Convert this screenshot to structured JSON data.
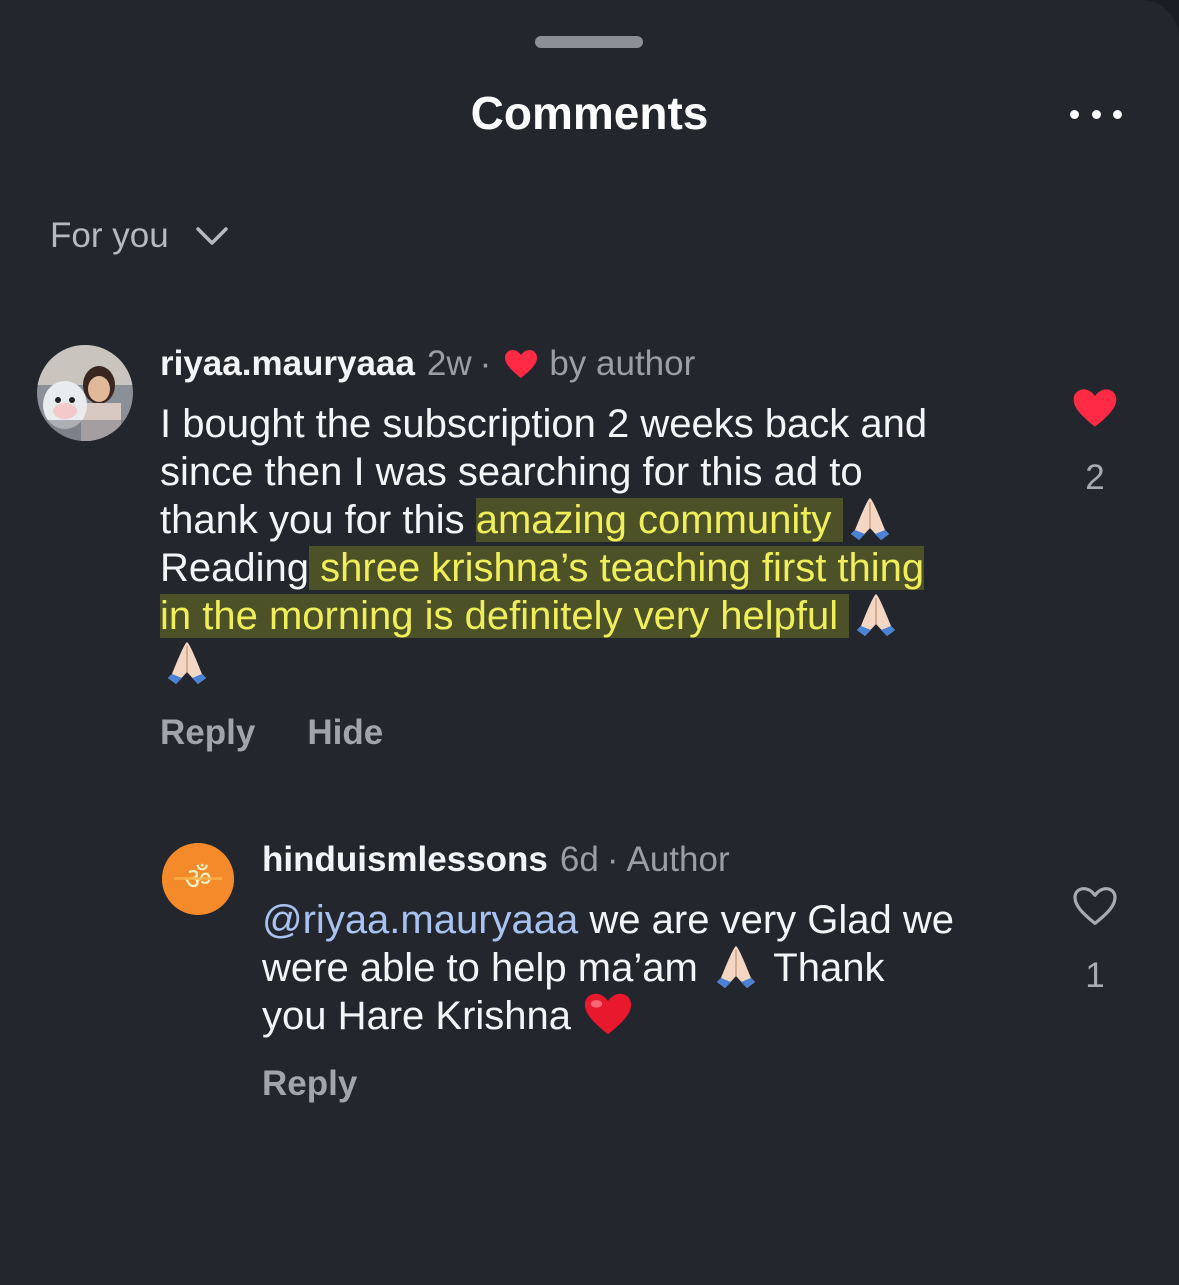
{
  "header": {
    "title": "Comments",
    "more_icon": "more-horizontal-icon"
  },
  "filter": {
    "label": "For you",
    "icon": "chevron-down-icon"
  },
  "colors": {
    "background": "#24262e",
    "highlight_text": "#f0ef5a",
    "highlight_bg": "#4c5128",
    "like_red": "#ff2a44",
    "mention": "#a9c3f0"
  },
  "comments": [
    {
      "username": "riyaa.mauryaaa",
      "time": "2w",
      "separator": "·",
      "author_like_label": "by author",
      "lines": {
        "l1": "I bought the subscription 2 weeks back and",
        "l2": "since then I was searching for this ad to",
        "l3_plain": "thank you for this ",
        "l3_highlight": "amazing community ",
        "l4_plain": "Reading",
        "l4_highlight": " shree krishna’s teaching first thing",
        "l5_highlight": "in the morning is definitely very helpful "
      },
      "actions": {
        "reply": "Reply",
        "hide": "Hide"
      },
      "liked": true,
      "like_count": "2"
    },
    {
      "username": "hinduismlessons",
      "time": "6d",
      "separator": "·",
      "badge": "Author",
      "lines": {
        "mention": "@riyaa.mauryaaa",
        "l1_rest": " we are very Glad we",
        "l2a": "were able to help ma’am ",
        "l2b": " Thank",
        "l3": "you Hare Krishna "
      },
      "actions": {
        "reply": "Reply"
      },
      "liked": false,
      "like_count": "1"
    }
  ]
}
